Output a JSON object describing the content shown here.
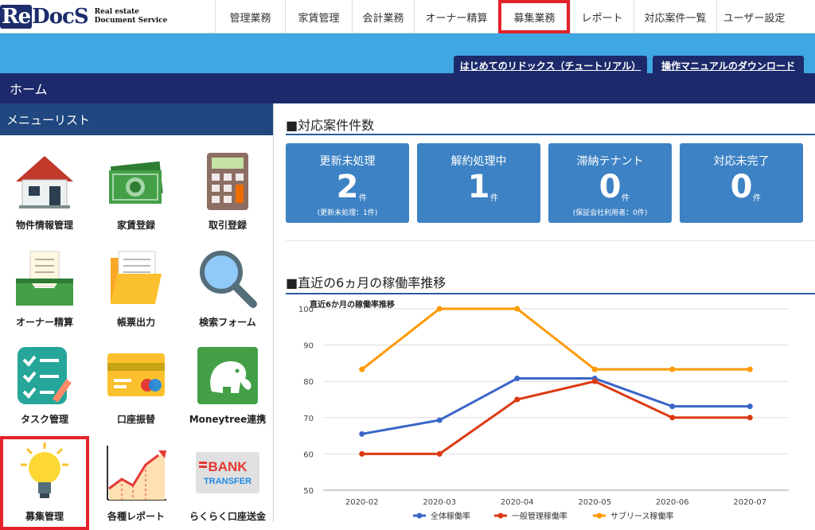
{
  "logo": {
    "mark_re": "Re",
    "mark_rest": "DocS",
    "sub_line1": "Real estate",
    "sub_line2": "Document Service"
  },
  "nav": [
    {
      "label": "管理業務"
    },
    {
      "label": "家賃管理"
    },
    {
      "label": "会計業務"
    },
    {
      "label": "オーナー精算"
    },
    {
      "label": "募集業務",
      "active": true
    },
    {
      "label": "レポート"
    },
    {
      "label": "対応案件一覧"
    },
    {
      "label": "ユーザー設定"
    }
  ],
  "banner": {
    "tutorial": "はじめてのリドックス（チュートリアル）",
    "manual": "操作マニュアルのダウンロード"
  },
  "home": {
    "title": "ホーム"
  },
  "sidebar": {
    "title": "メニューリスト",
    "items": [
      {
        "label": "物件情報管理",
        "icon": "house-icon"
      },
      {
        "label": "家賃登録",
        "icon": "money-icon"
      },
      {
        "label": "取引登録",
        "icon": "calculator-icon"
      },
      {
        "label": "オーナー精算",
        "icon": "inbox-tray-icon"
      },
      {
        "label": "帳票出力",
        "icon": "folder-icon"
      },
      {
        "label": "検索フォーム",
        "icon": "magnifier-icon"
      },
      {
        "label": "タスク管理",
        "icon": "checklist-icon"
      },
      {
        "label": "口座振替",
        "icon": "credit-card-icon"
      },
      {
        "label": "Moneytree連携",
        "icon": "elephant-icon"
      },
      {
        "label": "募集管理",
        "icon": "lightbulb-icon",
        "selected": true
      },
      {
        "label": "各種レポート",
        "icon": "growth-chart-icon"
      },
      {
        "label": "らくらく口座送金",
        "icon": "bank-transfer-icon"
      }
    ]
  },
  "cases": {
    "title": "■対応案件件数",
    "unit": "件",
    "cards": [
      {
        "title": "更新未処理",
        "count": "2",
        "sub": "(更新未処理：1件)"
      },
      {
        "title": "解約処理中",
        "count": "1",
        "sub": ""
      },
      {
        "title": "滞納テナント",
        "count": "0",
        "sub": "(保証会社利用者：0件)"
      },
      {
        "title": "対応未完了",
        "count": "0",
        "sub": ""
      }
    ]
  },
  "occupancy": {
    "title": "■直近の6ヵ月の稼働率推移"
  },
  "bank_icon": {
    "line1": "BANK",
    "line2": "TRANSFER"
  },
  "chart_data": {
    "type": "line",
    "title": "直近6か月の稼働率推移",
    "categories": [
      "2020-02",
      "2020-03",
      "2020-04",
      "2020-05",
      "2020-06",
      "2020-07"
    ],
    "ylim": [
      50,
      100
    ],
    "yticks": [
      "50",
      "60",
      "70",
      "80",
      "90",
      "100"
    ],
    "grid": true,
    "legend": "bottom",
    "series": [
      {
        "name": "全体稼働率",
        "color": "#3a66c8",
        "values": [
          65.5,
          69.3,
          80.8,
          80.8,
          73.1,
          73.1
        ]
      },
      {
        "name": "一般管理稼働率",
        "color": "#dc3912",
        "values": [
          60,
          60,
          75,
          80,
          70,
          70
        ]
      },
      {
        "name": "サブリース稼働率",
        "color": "#ff9900",
        "values": [
          83.3,
          100,
          100,
          83.3,
          83.3,
          83.3
        ]
      }
    ]
  }
}
